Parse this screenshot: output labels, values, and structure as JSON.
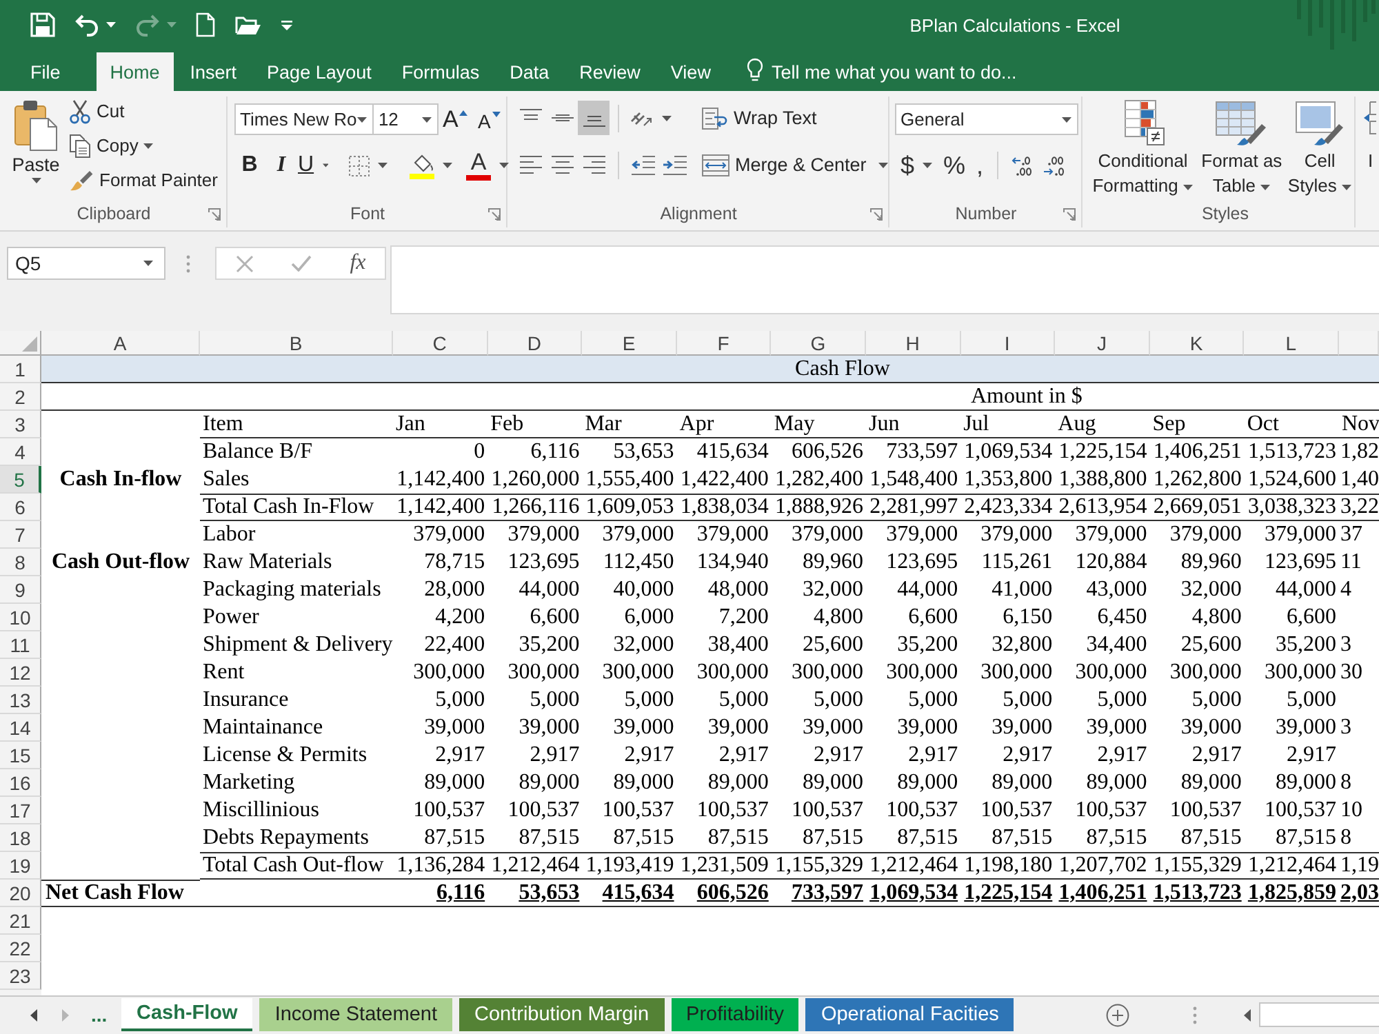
{
  "window": {
    "title": "BPlan Calculations - Excel"
  },
  "quick_access": [
    {
      "kind": "save",
      "dropdown": false,
      "disabled": false
    },
    {
      "kind": "undo",
      "dropdown": true,
      "disabled": false
    },
    {
      "kind": "redo",
      "dropdown": true,
      "disabled": true
    },
    {
      "kind": "new",
      "dropdown": false,
      "disabled": false
    },
    {
      "kind": "open",
      "dropdown": false,
      "disabled": false
    },
    {
      "kind": "customize",
      "dropdown": false,
      "disabled": false
    }
  ],
  "ribbon_tabs": [
    {
      "label": "File",
      "selected": false
    },
    {
      "label": "Home",
      "selected": true
    },
    {
      "label": "Insert",
      "selected": false
    },
    {
      "label": "Page Layout",
      "selected": false
    },
    {
      "label": "Formulas",
      "selected": false
    },
    {
      "label": "Data",
      "selected": false
    },
    {
      "label": "Review",
      "selected": false
    },
    {
      "label": "View",
      "selected": false
    }
  ],
  "tell_me": {
    "placeholder": "Tell me what you want to do..."
  },
  "clipboard": {
    "label": "Clipboard",
    "launcher": true,
    "paste": "Paste",
    "actions": [
      {
        "kind": "cut",
        "label": "Cut",
        "dropdown": false
      },
      {
        "kind": "copy",
        "label": "Copy",
        "dropdown": true
      },
      {
        "kind": "format_painter",
        "label": "Format Painter",
        "dropdown": false
      }
    ]
  },
  "font": {
    "label": "Font",
    "launcher": true,
    "name": "Times New Ro",
    "size": "12",
    "grow": "A",
    "shrink": "A",
    "styles": [
      {
        "kind": "bold",
        "label": "B",
        "dropdown": false
      },
      {
        "kind": "italic",
        "label": "I",
        "dropdown": false
      },
      {
        "kind": "underline",
        "label": "U",
        "dropdown": true
      }
    ],
    "font_color": "A"
  },
  "alignment": {
    "label": "Alignment",
    "launcher": true,
    "vertical": [
      {
        "kind": "top",
        "selected": false
      },
      {
        "kind": "middle",
        "selected": false
      },
      {
        "kind": "bottom",
        "selected": true
      }
    ],
    "horizontal": [
      {
        "kind": "left",
        "selected": false
      },
      {
        "kind": "center",
        "selected": false
      },
      {
        "kind": "right",
        "selected": false
      }
    ],
    "wrap": "Wrap Text",
    "merge": "Merge & Center"
  },
  "number": {
    "label": "Number",
    "launcher": true,
    "format": "General",
    "symbols": [
      {
        "label": "$",
        "dropdown": true
      },
      {
        "label": "%",
        "dropdown": false
      },
      {
        "label": ",",
        "dropdown": false
      }
    ]
  },
  "styles": {
    "label": "Styles",
    "launcher": false,
    "buttons": [
      {
        "kind": "conditional",
        "label": "Conditional Formatting",
        "dropdown": true
      },
      {
        "kind": "table",
        "label": "Format as Table",
        "dropdown": true
      },
      {
        "kind": "cell",
        "label": "Cell Styles",
        "dropdown": true
      }
    ]
  },
  "cells_partial": {
    "label": "I"
  },
  "formula_bar": {
    "name_box": "Q5",
    "function_label": "fx"
  },
  "sheet": {
    "columns": [
      "A",
      "B",
      "C",
      "D",
      "E",
      "F",
      "G",
      "H",
      "I",
      "J",
      "K",
      "L"
    ],
    "rows": [
      {
        "label": "1",
        "selected": false
      },
      {
        "label": "2",
        "selected": false
      },
      {
        "label": "3",
        "selected": false
      },
      {
        "label": "4",
        "selected": false
      },
      {
        "label": "5",
        "selected": true
      },
      {
        "label": "6",
        "selected": false
      },
      {
        "label": "7",
        "selected": false
      },
      {
        "label": "8",
        "selected": false
      },
      {
        "label": "9",
        "selected": false
      },
      {
        "label": "10",
        "selected": false
      },
      {
        "label": "11",
        "selected": false
      },
      {
        "label": "12",
        "selected": false
      },
      {
        "label": "13",
        "selected": false
      },
      {
        "label": "14",
        "selected": false
      },
      {
        "label": "15",
        "selected": false
      },
      {
        "label": "16",
        "selected": false
      },
      {
        "label": "17",
        "selected": false
      },
      {
        "label": "18",
        "selected": false
      },
      {
        "label": "19",
        "selected": false
      },
      {
        "label": "20",
        "selected": false
      },
      {
        "label": "21",
        "selected": false
      },
      {
        "label": "22",
        "selected": false
      },
      {
        "label": "23",
        "selected": false
      }
    ],
    "title": "Cash Flow",
    "note": "Amount in $",
    "item_heading": "Item",
    "months": [
      "Jan",
      "Feb",
      "Mar",
      "Apr",
      "May",
      "Jun",
      "Jul",
      "Aug",
      "Sep",
      "Oct",
      "Nov"
    ],
    "lines": [
      {
        "kind": "item",
        "item": "Balance B/F",
        "values": [
          "0",
          "6,116",
          "53,653",
          "415,634",
          "606,526",
          "733,597",
          "1,069,534",
          "1,225,154",
          "1,406,251",
          "1,513,723",
          "1,82"
        ]
      },
      {
        "kind": "item",
        "group": "Cash In-flow",
        "item": "Sales",
        "values": [
          "1,142,400",
          "1,260,000",
          "1,555,400",
          "1,422,400",
          "1,282,400",
          "1,548,400",
          "1,353,800",
          "1,388,800",
          "1,262,800",
          "1,524,600",
          "1,40"
        ]
      },
      {
        "kind": "total",
        "item": "Total Cash In-Flow",
        "values": [
          "1,142,400",
          "1,266,116",
          "1,609,053",
          "1,838,034",
          "1,888,926",
          "2,281,997",
          "2,423,334",
          "2,613,954",
          "2,669,051",
          "3,038,323",
          "3,22"
        ]
      },
      {
        "kind": "item",
        "item": "Labor",
        "values": [
          "379,000",
          "379,000",
          "379,000",
          "379,000",
          "379,000",
          "379,000",
          "379,000",
          "379,000",
          "379,000",
          "379,000",
          "37"
        ]
      },
      {
        "kind": "item",
        "group": "Cash Out-flow",
        "item": "Raw Materials",
        "values": [
          "78,715",
          "123,695",
          "112,450",
          "134,940",
          "89,960",
          "123,695",
          "115,261",
          "120,884",
          "89,960",
          "123,695",
          "11"
        ]
      },
      {
        "kind": "item",
        "item": "Packaging materials",
        "values": [
          "28,000",
          "44,000",
          "40,000",
          "48,000",
          "32,000",
          "44,000",
          "41,000",
          "43,000",
          "32,000",
          "44,000",
          "4"
        ]
      },
      {
        "kind": "item",
        "item": "Power",
        "values": [
          "4,200",
          "6,600",
          "6,000",
          "7,200",
          "4,800",
          "6,600",
          "6,150",
          "6,450",
          "4,800",
          "6,600"
        ]
      },
      {
        "kind": "item",
        "item": "Shipment & Delivery",
        "values": [
          "22,400",
          "35,200",
          "32,000",
          "38,400",
          "25,600",
          "35,200",
          "32,800",
          "34,400",
          "25,600",
          "35,200",
          "3"
        ]
      },
      {
        "kind": "item",
        "item": "Rent",
        "values": [
          "300,000",
          "300,000",
          "300,000",
          "300,000",
          "300,000",
          "300,000",
          "300,000",
          "300,000",
          "300,000",
          "300,000",
          "30"
        ]
      },
      {
        "kind": "item",
        "item": "Insurance",
        "values": [
          "5,000",
          "5,000",
          "5,000",
          "5,000",
          "5,000",
          "5,000",
          "5,000",
          "5,000",
          "5,000",
          "5,000"
        ]
      },
      {
        "kind": "item",
        "item": "Maintainance",
        "values": [
          "39,000",
          "39,000",
          "39,000",
          "39,000",
          "39,000",
          "39,000",
          "39,000",
          "39,000",
          "39,000",
          "39,000",
          "3"
        ]
      },
      {
        "kind": "item",
        "item": "License & Permits",
        "values": [
          "2,917",
          "2,917",
          "2,917",
          "2,917",
          "2,917",
          "2,917",
          "2,917",
          "2,917",
          "2,917",
          "2,917"
        ]
      },
      {
        "kind": "item",
        "item": "Marketing",
        "values": [
          "89,000",
          "89,000",
          "89,000",
          "89,000",
          "89,000",
          "89,000",
          "89,000",
          "89,000",
          "89,000",
          "89,000",
          "8"
        ]
      },
      {
        "kind": "item",
        "item": "Miscillinious",
        "values": [
          "100,537",
          "100,537",
          "100,537",
          "100,537",
          "100,537",
          "100,537",
          "100,537",
          "100,537",
          "100,537",
          "100,537",
          "10"
        ]
      },
      {
        "kind": "item",
        "item": "Debts Repayments",
        "values": [
          "87,515",
          "87,515",
          "87,515",
          "87,515",
          "87,515",
          "87,515",
          "87,515",
          "87,515",
          "87,515",
          "87,515",
          "8"
        ]
      },
      {
        "kind": "total",
        "item": "Total Cash Out-flow",
        "values": [
          "1,136,284",
          "1,212,464",
          "1,193,419",
          "1,231,509",
          "1,155,329",
          "1,212,464",
          "1,198,180",
          "1,207,702",
          "1,155,329",
          "1,212,464",
          "1,19"
        ]
      },
      {
        "kind": "net",
        "group": "Net Cash Flow",
        "values": [
          "6,116",
          "53,653",
          "415,634",
          "606,526",
          "733,597",
          "1,069,534",
          "1,225,154",
          "1,406,251",
          "1,513,723",
          "1,825,859",
          "2,03"
        ]
      }
    ]
  },
  "sheet_nav": [
    {
      "kind": "previous",
      "disabled": false
    },
    {
      "kind": "next",
      "disabled": true
    }
  ],
  "more_sheets": "...",
  "sheet_tabs": [
    {
      "label": "Cash-Flow",
      "selected": true
    },
    {
      "label": "Income Statement",
      "selected": false,
      "color": "#a9d08e"
    },
    {
      "label": "Contribution Margin",
      "selected": false,
      "color": "#548235"
    },
    {
      "label": "Profitability",
      "selected": false,
      "color": "#00b050"
    },
    {
      "label": "Operational Facities",
      "selected": false,
      "color": "#2e75b6"
    }
  ]
}
